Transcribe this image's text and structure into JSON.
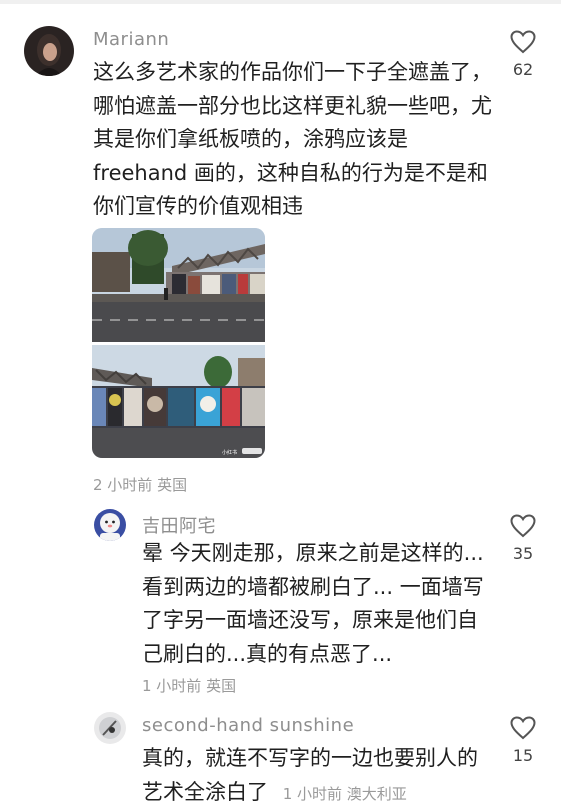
{
  "comments": [
    {
      "username": "Mariann",
      "lines": [
        "这么多艺术家的作品你们一下子全遮盖了，",
        "哪怕遮盖一部分也比这样更礼貌一些吧，尤",
        "其是你们拿纸板喷的，涂鸦应该是",
        "freehand 画的，这种自私的行为是不是和",
        "你们宣传的价值观相违"
      ],
      "likes": "62",
      "meta": "2 小时前 英国",
      "image_watermark": "小红书"
    },
    {
      "username": "吉田阿宅",
      "lines": [
        "晕 今天刚走那，原来之前是这样的...",
        "看到两边的墙都被刷白了... 一面墙写",
        "了字另一面墙还没写，原来是他们自",
        "己刷白的...真的有点恶了..."
      ],
      "likes": "35",
      "meta": "1 小时前 英国"
    },
    {
      "username": "second-hand sunshine",
      "lines": [
        "真的，就连不写字的一边也要别人的",
        "艺术全涂白了"
      ],
      "inline_meta": "1 小时前 澳大利亚",
      "likes": "15"
    }
  ],
  "icons": {
    "like": "heart-outline-icon"
  },
  "colors": {
    "username": "#8e8e8e",
    "meta": "#9a9a9a",
    "text": "#1f1f1f"
  }
}
